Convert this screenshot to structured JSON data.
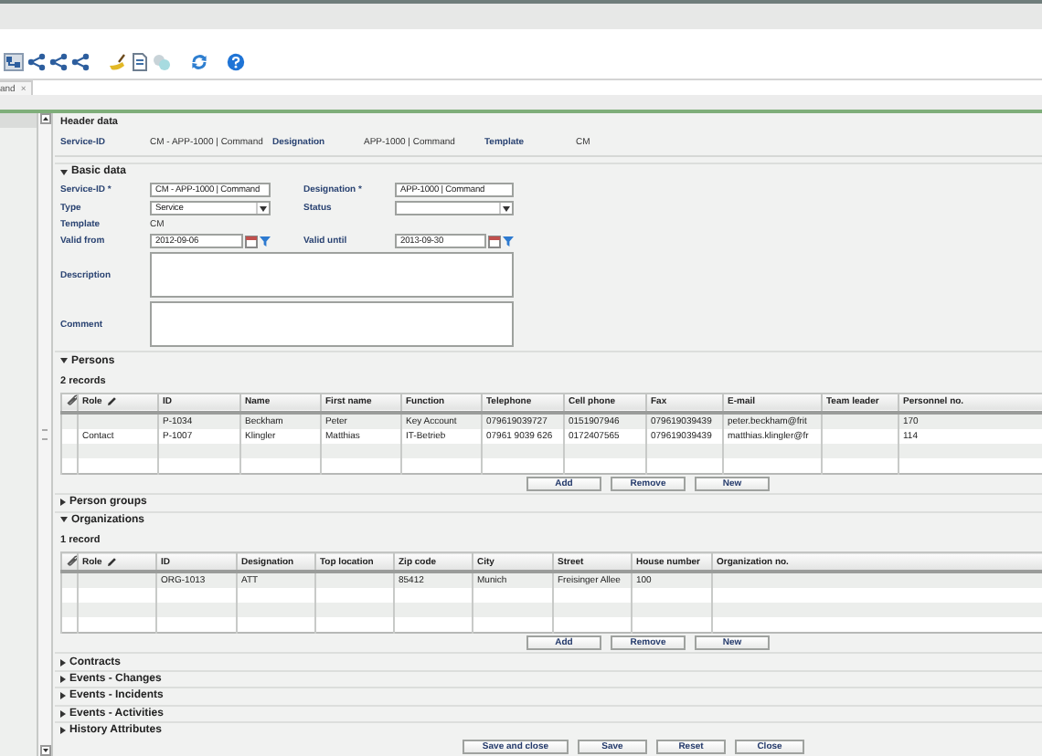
{
  "tab": {
    "label": "and",
    "close": "×"
  },
  "header_data": {
    "title": "Header data",
    "fields": [
      {
        "label": "Service-ID",
        "value": "CM - APP-1000 | Command"
      },
      {
        "label": "Designation",
        "value": "APP-1000 | Command"
      },
      {
        "label": "Template",
        "value": "CM"
      }
    ]
  },
  "basic_data": {
    "title": "Basic data",
    "expanded": true,
    "fields": [
      {
        "kind": "text",
        "label": "Service-ID *",
        "value": "CM - APP-1000 | Command"
      },
      {
        "kind": "text",
        "label": "Designation *",
        "value": "APP-1000 | Command"
      },
      {
        "kind": "select",
        "label": "Type",
        "value": "Service"
      },
      {
        "kind": "select",
        "label": "Status"
      },
      {
        "kind": "static",
        "label": "Template",
        "value": "CM"
      },
      {
        "kind": "date",
        "label": "Valid from",
        "value": "2012-09-06"
      },
      {
        "kind": "date",
        "label": "Valid until",
        "value": "2013-09-30"
      },
      {
        "kind": "textarea",
        "label": "Description"
      },
      {
        "kind": "textarea",
        "label": "Comment"
      }
    ]
  },
  "persons": {
    "title": "Persons",
    "expanded": true,
    "count": "2 records",
    "columns": [
      "Role",
      "ID",
      "Name",
      "First name",
      "Function",
      "Telephone",
      "Cell phone",
      "Fax",
      "E-mail",
      "Team leader",
      "Personnel no."
    ],
    "rows": [
      [
        "",
        "P-1034",
        "Beckham",
        "Peter",
        "Key Account",
        "079619039727",
        "0151907946",
        "079619039439",
        "peter.beckham@frit",
        "",
        "170"
      ],
      [
        "Contact",
        "P-1007",
        "Klingler",
        "Matthias",
        "IT-Betrieb",
        "07961 9039 626",
        "0172407565",
        "079619039439",
        "matthias.klingler@fr",
        "",
        "114"
      ]
    ],
    "buttons": [
      "Add",
      "Remove",
      "New"
    ]
  },
  "person_groups": {
    "title": "Person groups",
    "expanded": false
  },
  "organizations": {
    "title": "Organizations",
    "expanded": true,
    "count": "1 record",
    "columns": [
      "Role",
      "ID",
      "Designation",
      "Top location",
      "Zip code",
      "City",
      "Street",
      "House number",
      "Organization no."
    ],
    "rows": [
      [
        "",
        "ORG-1013",
        "ATT",
        "",
        "85412",
        "Munich",
        "Freisinger Allee",
        "100",
        ""
      ]
    ],
    "buttons": [
      "Add",
      "Remove",
      "New"
    ]
  },
  "collapsed_sections": [
    {
      "title": "Contracts",
      "expanded": false
    },
    {
      "title": "Events - Changes",
      "expanded": false
    },
    {
      "title": "Events - Incidents",
      "expanded": false
    },
    {
      "title": "Events - Activities",
      "expanded": false
    },
    {
      "title": "History Attributes",
      "expanded": false
    }
  ],
  "footer_buttons": [
    "Save and close",
    "Save",
    "Reset",
    "Close"
  ]
}
